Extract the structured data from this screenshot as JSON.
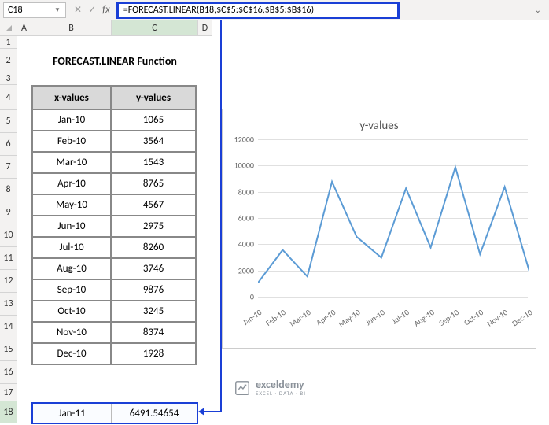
{
  "nameBox": {
    "value": "C18"
  },
  "formulaBar": {
    "value": "=FORECAST.LINEAR(B18,$C$5:$C$16,$B$5:$B$16)"
  },
  "columns": [
    "A",
    "B",
    "C",
    "D"
  ],
  "colWidths": {
    "A": 18,
    "B": 102,
    "C": 110,
    "D": 18
  },
  "rows": [
    "1",
    "2",
    "3",
    "4",
    "5",
    "6",
    "7",
    "8",
    "9",
    "10",
    "11",
    "12",
    "13",
    "14",
    "15",
    "16",
    "17",
    "18"
  ],
  "mainTitle": "FORECAST.LINEAR Function",
  "tableHeaders": {
    "x": "x-values",
    "y": "y-values"
  },
  "tableData": [
    {
      "x": "Jan-10",
      "y": "1065"
    },
    {
      "x": "Feb-10",
      "y": "3564"
    },
    {
      "x": "Mar-10",
      "y": "1543"
    },
    {
      "x": "Apr-10",
      "y": "8765"
    },
    {
      "x": "May-10",
      "y": "4567"
    },
    {
      "x": "Jun-10",
      "y": "2975"
    },
    {
      "x": "Jul-10",
      "y": "8260"
    },
    {
      "x": "Aug-10",
      "y": "3746"
    },
    {
      "x": "Sep-10",
      "y": "9876"
    },
    {
      "x": "Oct-10",
      "y": "3245"
    },
    {
      "x": "Nov-10",
      "y": "8374"
    },
    {
      "x": "Dec-10",
      "y": "1928"
    }
  ],
  "forecastRow": {
    "x": "Jan-11",
    "y": "6491.54654"
  },
  "chart_data": {
    "type": "line",
    "title": "y-values",
    "xlabel": "",
    "ylabel": "",
    "ylim": [
      0,
      12000
    ],
    "yticks": [
      0,
      2000,
      4000,
      6000,
      8000,
      10000,
      12000
    ],
    "categories": [
      "Jan-10",
      "Feb-10",
      "Mar-10",
      "Apr-10",
      "May-10",
      "Jun-10",
      "Jul-10",
      "Aug-10",
      "Sep-10",
      "Oct-10",
      "Nov-10",
      "Dec-10"
    ],
    "values": [
      1065,
      3564,
      1543,
      8765,
      4567,
      2975,
      8260,
      3746,
      9876,
      3245,
      8374,
      1928
    ]
  },
  "brand": {
    "name": "exceldemy",
    "tag": "EXCEL · DATA · BI"
  }
}
